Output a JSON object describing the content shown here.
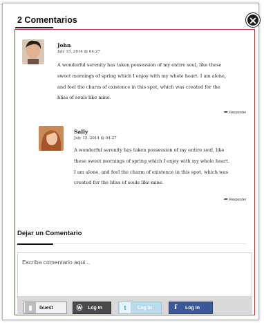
{
  "header": {
    "title": "2 Comentarios"
  },
  "comments": [
    {
      "author": "John",
      "date": "July 15, 2014 @ 04:27",
      "lines": [
        "A wonderful serenity has taken possession of my entire soul, like these",
        "sweet mornings of spring which I enjoy with my whole heart. I am alone,",
        "and feel the charm of existence in this spot, which was created for the",
        "bliss of souls like mine."
      ],
      "reply_label": "Responder"
    },
    {
      "author": "Sally",
      "date": "July 15, 2014 @ 04:27",
      "lines": [
        "A wonderful serenity has taken possession of my entire soul, like",
        "these sweet mornings of spring which I enjoy with my whole heart.",
        "I am alone, and feel the charm of existence in this spot, which was",
        "created for the bliss of souls like mine."
      ],
      "reply_label": "Responder"
    }
  ],
  "leave_comment": {
    "title": "Dejar un Comentario",
    "placeholder": "Escriba comentario aqui..."
  },
  "login_bar": {
    "guest_label": "Guest",
    "wordpress_label": "Log In",
    "twitter_label": "Log In",
    "facebook_label": "Log In"
  },
  "colors": {
    "frame_border": "#b03a3a",
    "facebook_blue": "#3b5998",
    "twitter_light": "#b8dcec"
  }
}
